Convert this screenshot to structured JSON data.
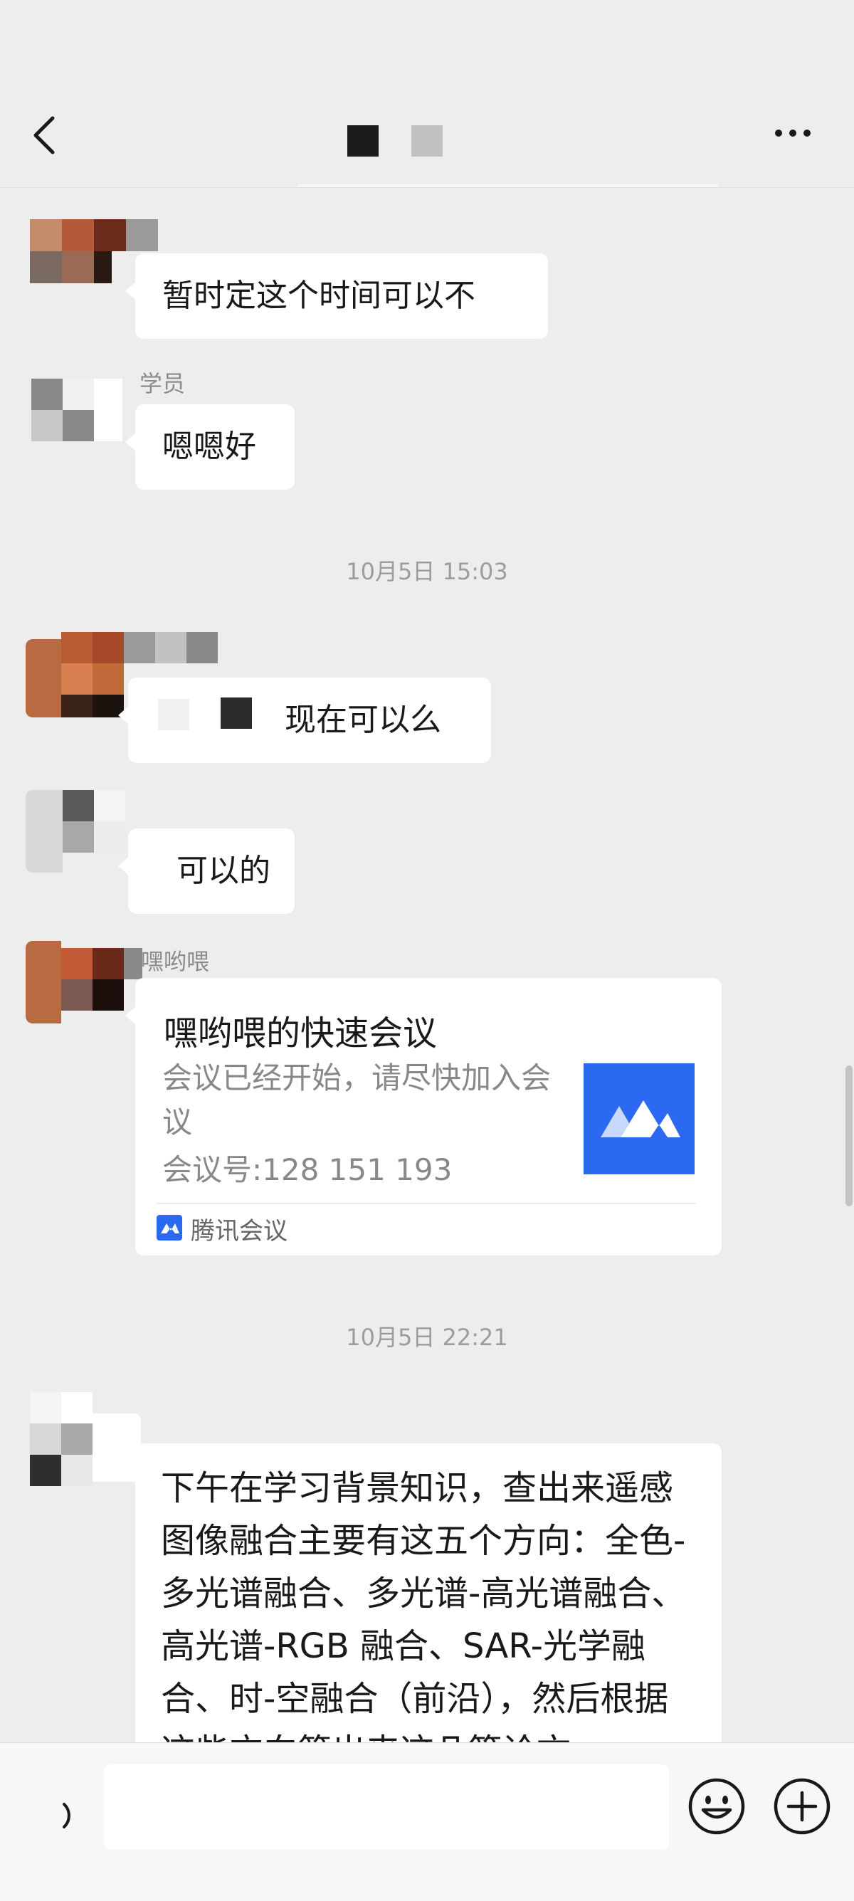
{
  "header": {
    "back_icon": "chevron-left-icon",
    "more_icon": "more-dots-icon"
  },
  "messages": [
    {
      "text": "暂时定这个时间可以不"
    },
    {
      "sender": "学员",
      "text": "嗯嗯好"
    },
    {
      "time": "10月5日 15:03"
    },
    {
      "text": "现在可以么"
    },
    {
      "text": "可以的"
    },
    {
      "sender": "嘿哟喂",
      "card": {
        "title": "嘿哟喂的快速会议",
        "desc": "会议已经开始，请尽快加入会议",
        "number": "会议号:128 151 193",
        "source": "腾讯会议"
      }
    },
    {
      "time": "10月5日 22:21"
    },
    {
      "text": "下午在学习背景知识，查出来遥感图像融合主要有这五个方向：全色-多光谱融合、多光谱-高光谱融合、高光谱-RGB 融合、SAR-光学融合、时-空融合（前沿），然后根据这些方向筛出来这几篇论文"
    }
  ],
  "input_bar": {
    "placeholder": "",
    "voice_icon": "voice-icon",
    "emoji_icon": "emoji-icon",
    "plus_icon": "plus-icon"
  },
  "colors": {
    "background": "#ededed",
    "bubble": "#ffffff",
    "meeting_blue": "#2b6af0"
  }
}
